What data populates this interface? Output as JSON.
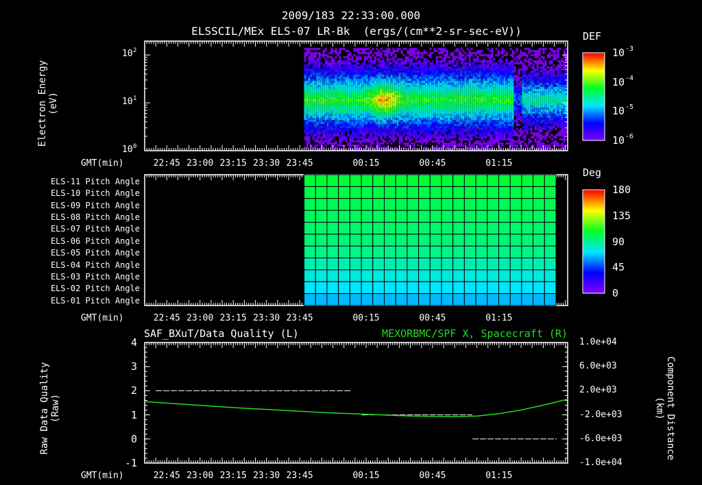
{
  "header": {
    "datetime": "2009/183 22:33:00.000",
    "title": "ELSSCIL/MEx ELS-07 LR-Bk  (ergs/(cm**2-sr-sec-eV))"
  },
  "time_axis": {
    "label": "GMT(min)",
    "ticks": [
      "22:45",
      "23:00",
      "23:15",
      "23:30",
      "23:45",
      "00:15",
      "00:45",
      "01:15"
    ],
    "tick_minutes": [
      10,
      25,
      40,
      55,
      70,
      100,
      130,
      160
    ],
    "range_minutes_from_2235": [
      0,
      191
    ]
  },
  "chart_data": [
    {
      "type": "heatmap",
      "title": "ELSSCIL/MEx ELS-07 LR-Bk",
      "ylabel": "Electron Energy",
      "yunit": "(eV)",
      "yscale": "log",
      "ylim": [
        1,
        150
      ],
      "yticks": [
        "10",
        "10",
        "10"
      ],
      "ytick_exp": [
        "2",
        "1",
        "0"
      ],
      "colorbar": {
        "label": "DEF",
        "ticks": [
          "10",
          "10",
          "10",
          "10"
        ],
        "tick_exp": [
          "-3",
          "-4",
          "-5",
          "-6"
        ],
        "range": [
          1e-06,
          0.001
        ]
      },
      "data_start_minute": 72,
      "band_center_eV": 12,
      "peak_time_minute": 108
    },
    {
      "type": "heatmap",
      "title": "Pitch Angle",
      "rows": [
        "ELS-11 Pitch Angle",
        "ELS-10 Pitch Angle",
        "ELS-09 Pitch Angle",
        "ELS-08 Pitch Angle",
        "ELS-07 Pitch Angle",
        "ELS-06 Pitch Angle",
        "ELS-05 Pitch Angle",
        "ELS-04 Pitch Angle",
        "ELS-03 Pitch Angle",
        "ELS-02 Pitch Angle",
        "ELS-01 Pitch Angle"
      ],
      "row_values_deg": [
        105,
        103,
        101,
        99,
        97,
        95,
        92,
        85,
        78,
        72,
        65
      ],
      "colorbar": {
        "label": "Deg",
        "ticks": [
          "180",
          "135",
          "90",
          "45",
          "0"
        ],
        "range": [
          0,
          180
        ]
      },
      "data_range_minutes": [
        72,
        186
      ]
    },
    {
      "type": "line",
      "title_left": "SAF_BXuT/Data Quality (L)",
      "title_right": "MEXORBMC/SPF X, Spacecraft (R)",
      "ylabel_left": "Raw Data Quality",
      "yunit_left": "(Raw)",
      "ylim_left": [
        -1,
        4
      ],
      "yticks_left": [
        "4",
        "3",
        "2",
        "1",
        "0",
        "-1"
      ],
      "ylabel_right": "Component Distance",
      "yunit_right": "(km)",
      "ylim_right": [
        -10000,
        10000
      ],
      "yticks_right": [
        "1.0e+04",
        "6.0e+03",
        "2.0e+03",
        "-2.0e+03",
        "-6.0e+03",
        "-1.0e+04"
      ],
      "series": [
        {
          "name": "Data Quality",
          "color": "#ffffff",
          "segments": [
            {
              "x": [
                5,
                93
              ],
              "y": 2
            },
            {
              "x": [
                98,
                148
              ],
              "y": 1
            },
            {
              "x": [
                148,
                186
              ],
              "y": 0
            }
          ]
        },
        {
          "name": "Spacecraft X",
          "color": "#22dd22",
          "x": [
            0,
            20,
            40,
            60,
            80,
            100,
            120,
            140,
            150,
            160,
            170,
            180,
            191
          ],
          "y": [
            200,
            -300,
            -800,
            -1200,
            -1600,
            -1900,
            -2200,
            -2300,
            -2200,
            -1800,
            -1200,
            -400,
            600
          ]
        }
      ]
    }
  ]
}
